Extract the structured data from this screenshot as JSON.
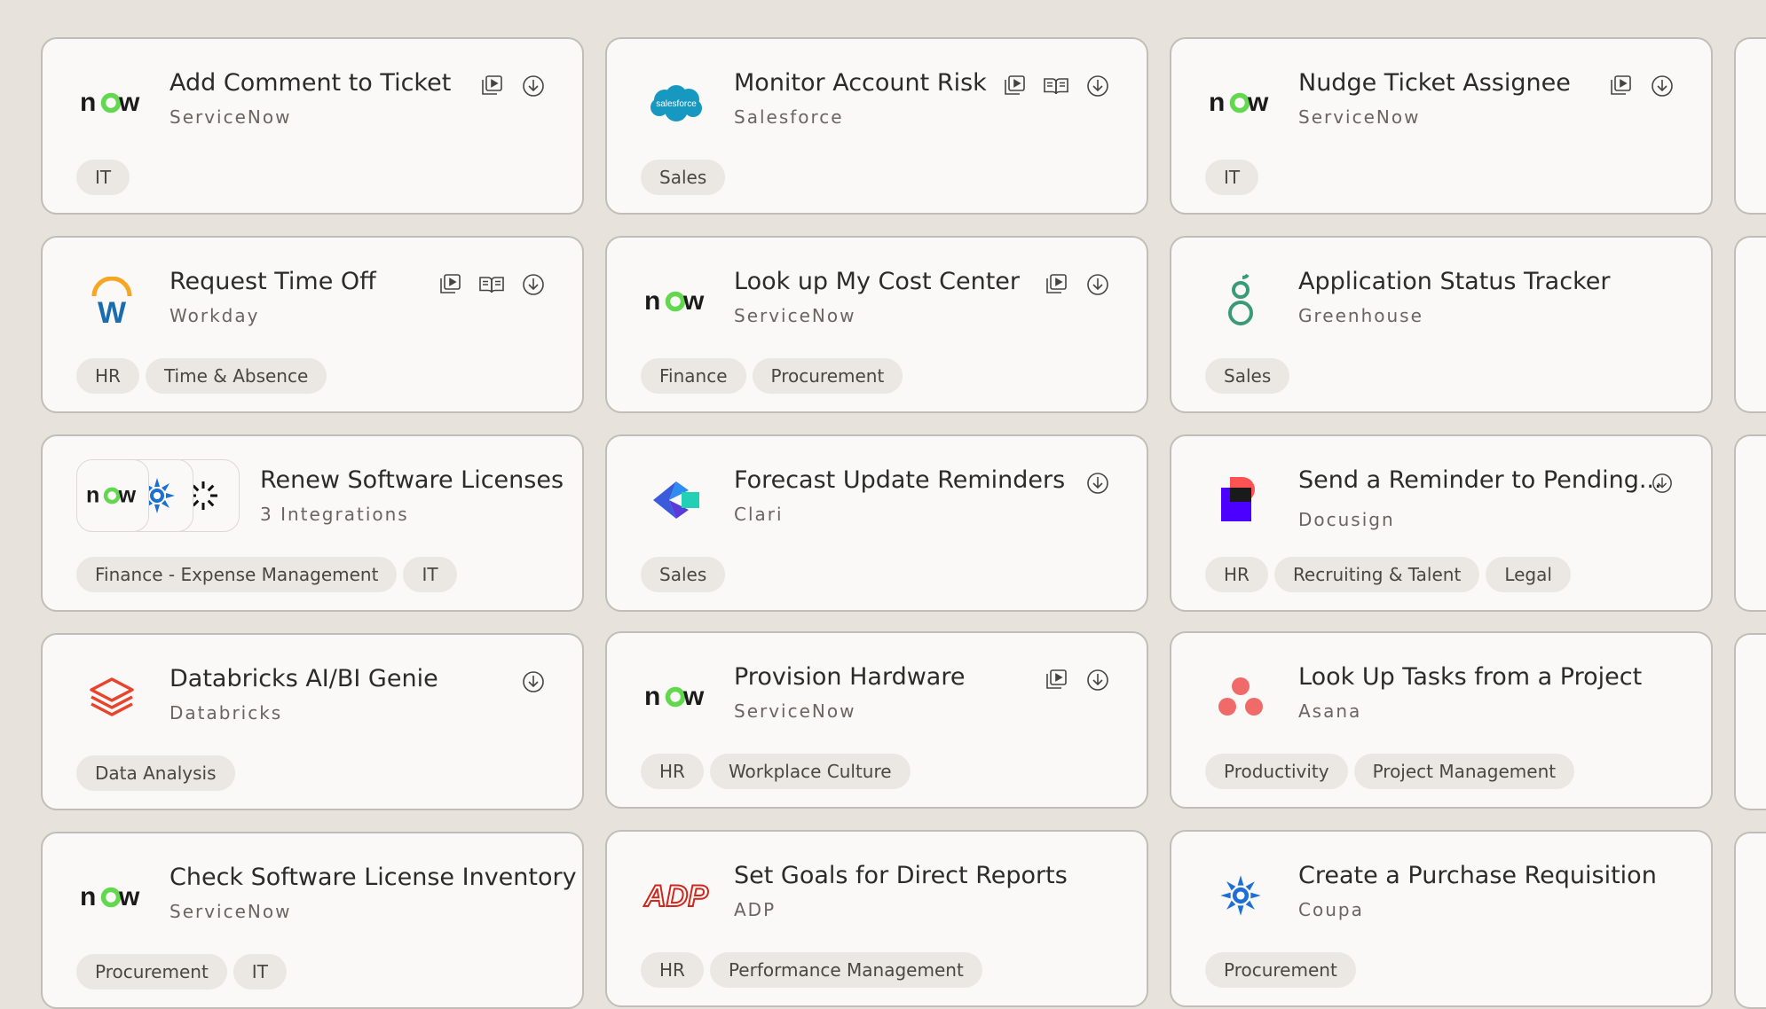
{
  "cards": [
    {
      "title": "Add Comment to Ticket",
      "subtitle": "ServiceNow",
      "logo": "servicenow-logo",
      "actions": [
        "video-icon",
        "download-icon"
      ],
      "tags": [
        "IT"
      ]
    },
    {
      "title": "Monitor Account Risk",
      "subtitle": "Salesforce",
      "logo": "salesforce-logo",
      "logo_text": "salesforce",
      "actions": [
        "video-icon",
        "book-icon",
        "download-icon"
      ],
      "tags": [
        "Sales"
      ]
    },
    {
      "title": "Nudge Ticket Assignee",
      "subtitle": "ServiceNow",
      "logo": "servicenow-logo",
      "actions": [
        "video-icon",
        "download-icon"
      ],
      "tags": [
        "IT"
      ]
    },
    {
      "title": "Request Time Off",
      "subtitle": "Workday",
      "logo": "workday-logo",
      "actions": [
        "video-icon",
        "book-icon",
        "download-icon"
      ],
      "tags": [
        "HR",
        "Time & Absence"
      ]
    },
    {
      "title": "Look up My Cost Center",
      "subtitle": "ServiceNow",
      "logo": "servicenow-logo",
      "actions": [
        "video-icon",
        "download-icon"
      ],
      "tags": [
        "Finance",
        "Procurement"
      ]
    },
    {
      "title": "Application Status Tracker",
      "subtitle": "Greenhouse",
      "logo": "greenhouse-logo",
      "actions": [],
      "tags": [
        "Sales"
      ]
    },
    {
      "title": "Renew Software Licenses",
      "subtitle": "3 Integrations",
      "logo": "multi-integration-logo",
      "actions": [],
      "tags": [
        "Finance - Expense Management",
        "IT"
      ]
    },
    {
      "title": "Forecast Update Reminders",
      "subtitle": "Clari",
      "logo": "clari-logo",
      "actions": [
        "download-icon"
      ],
      "tags": [
        "Sales"
      ]
    },
    {
      "title": "Send a Reminder to Pending...",
      "subtitle": "Docusign",
      "logo": "docusign-logo",
      "actions": [
        "download-icon"
      ],
      "tags": [
        "HR",
        "Recruiting & Talent",
        "Legal"
      ]
    },
    {
      "title": "Databricks AI/BI Genie",
      "subtitle": "Databricks",
      "logo": "databricks-logo",
      "actions": [
        "download-icon"
      ],
      "tags": [
        "Data Analysis"
      ]
    },
    {
      "title": "Provision Hardware",
      "subtitle": "ServiceNow",
      "logo": "servicenow-logo",
      "actions": [
        "video-icon",
        "download-icon"
      ],
      "tags": [
        "HR",
        "Workplace Culture"
      ]
    },
    {
      "title": "Look Up Tasks from a Project",
      "subtitle": "Asana",
      "logo": "asana-logo",
      "actions": [],
      "tags": [
        "Productivity",
        "Project Management"
      ]
    },
    {
      "title": "Check Software License Inventory",
      "subtitle": "ServiceNow",
      "logo": "servicenow-logo",
      "actions": [],
      "tags": [
        "Procurement",
        "IT"
      ]
    },
    {
      "title": "Set Goals for Direct Reports",
      "subtitle": "ADP",
      "logo": "adp-logo",
      "actions": [],
      "tags": [
        "HR",
        "Performance Management"
      ]
    },
    {
      "title": "Create a Purchase Requisition",
      "subtitle": "Coupa",
      "logo": "coupa-logo",
      "actions": [],
      "tags": [
        "Procurement"
      ]
    }
  ],
  "logo_texts": {
    "servicenow": "now",
    "adp": "ADP",
    "salesforce": "salesforce"
  },
  "colors": {
    "background": "#e7e2dc",
    "card": "#faf9f7",
    "card_border": "#c2bdb7",
    "tag_bg": "#ebe7e2",
    "servicenow_green": "#62d84e",
    "salesforce_blue": "#1798c1",
    "workday_orange": "#f5a623",
    "workday_blue": "#1a6cb0",
    "greenhouse_green": "#3a9a7a",
    "databricks_red": "#e8432d",
    "asana_coral": "#f06a6a",
    "adp_red": "#d0271d",
    "coupa_blue": "#1d6fd6"
  }
}
